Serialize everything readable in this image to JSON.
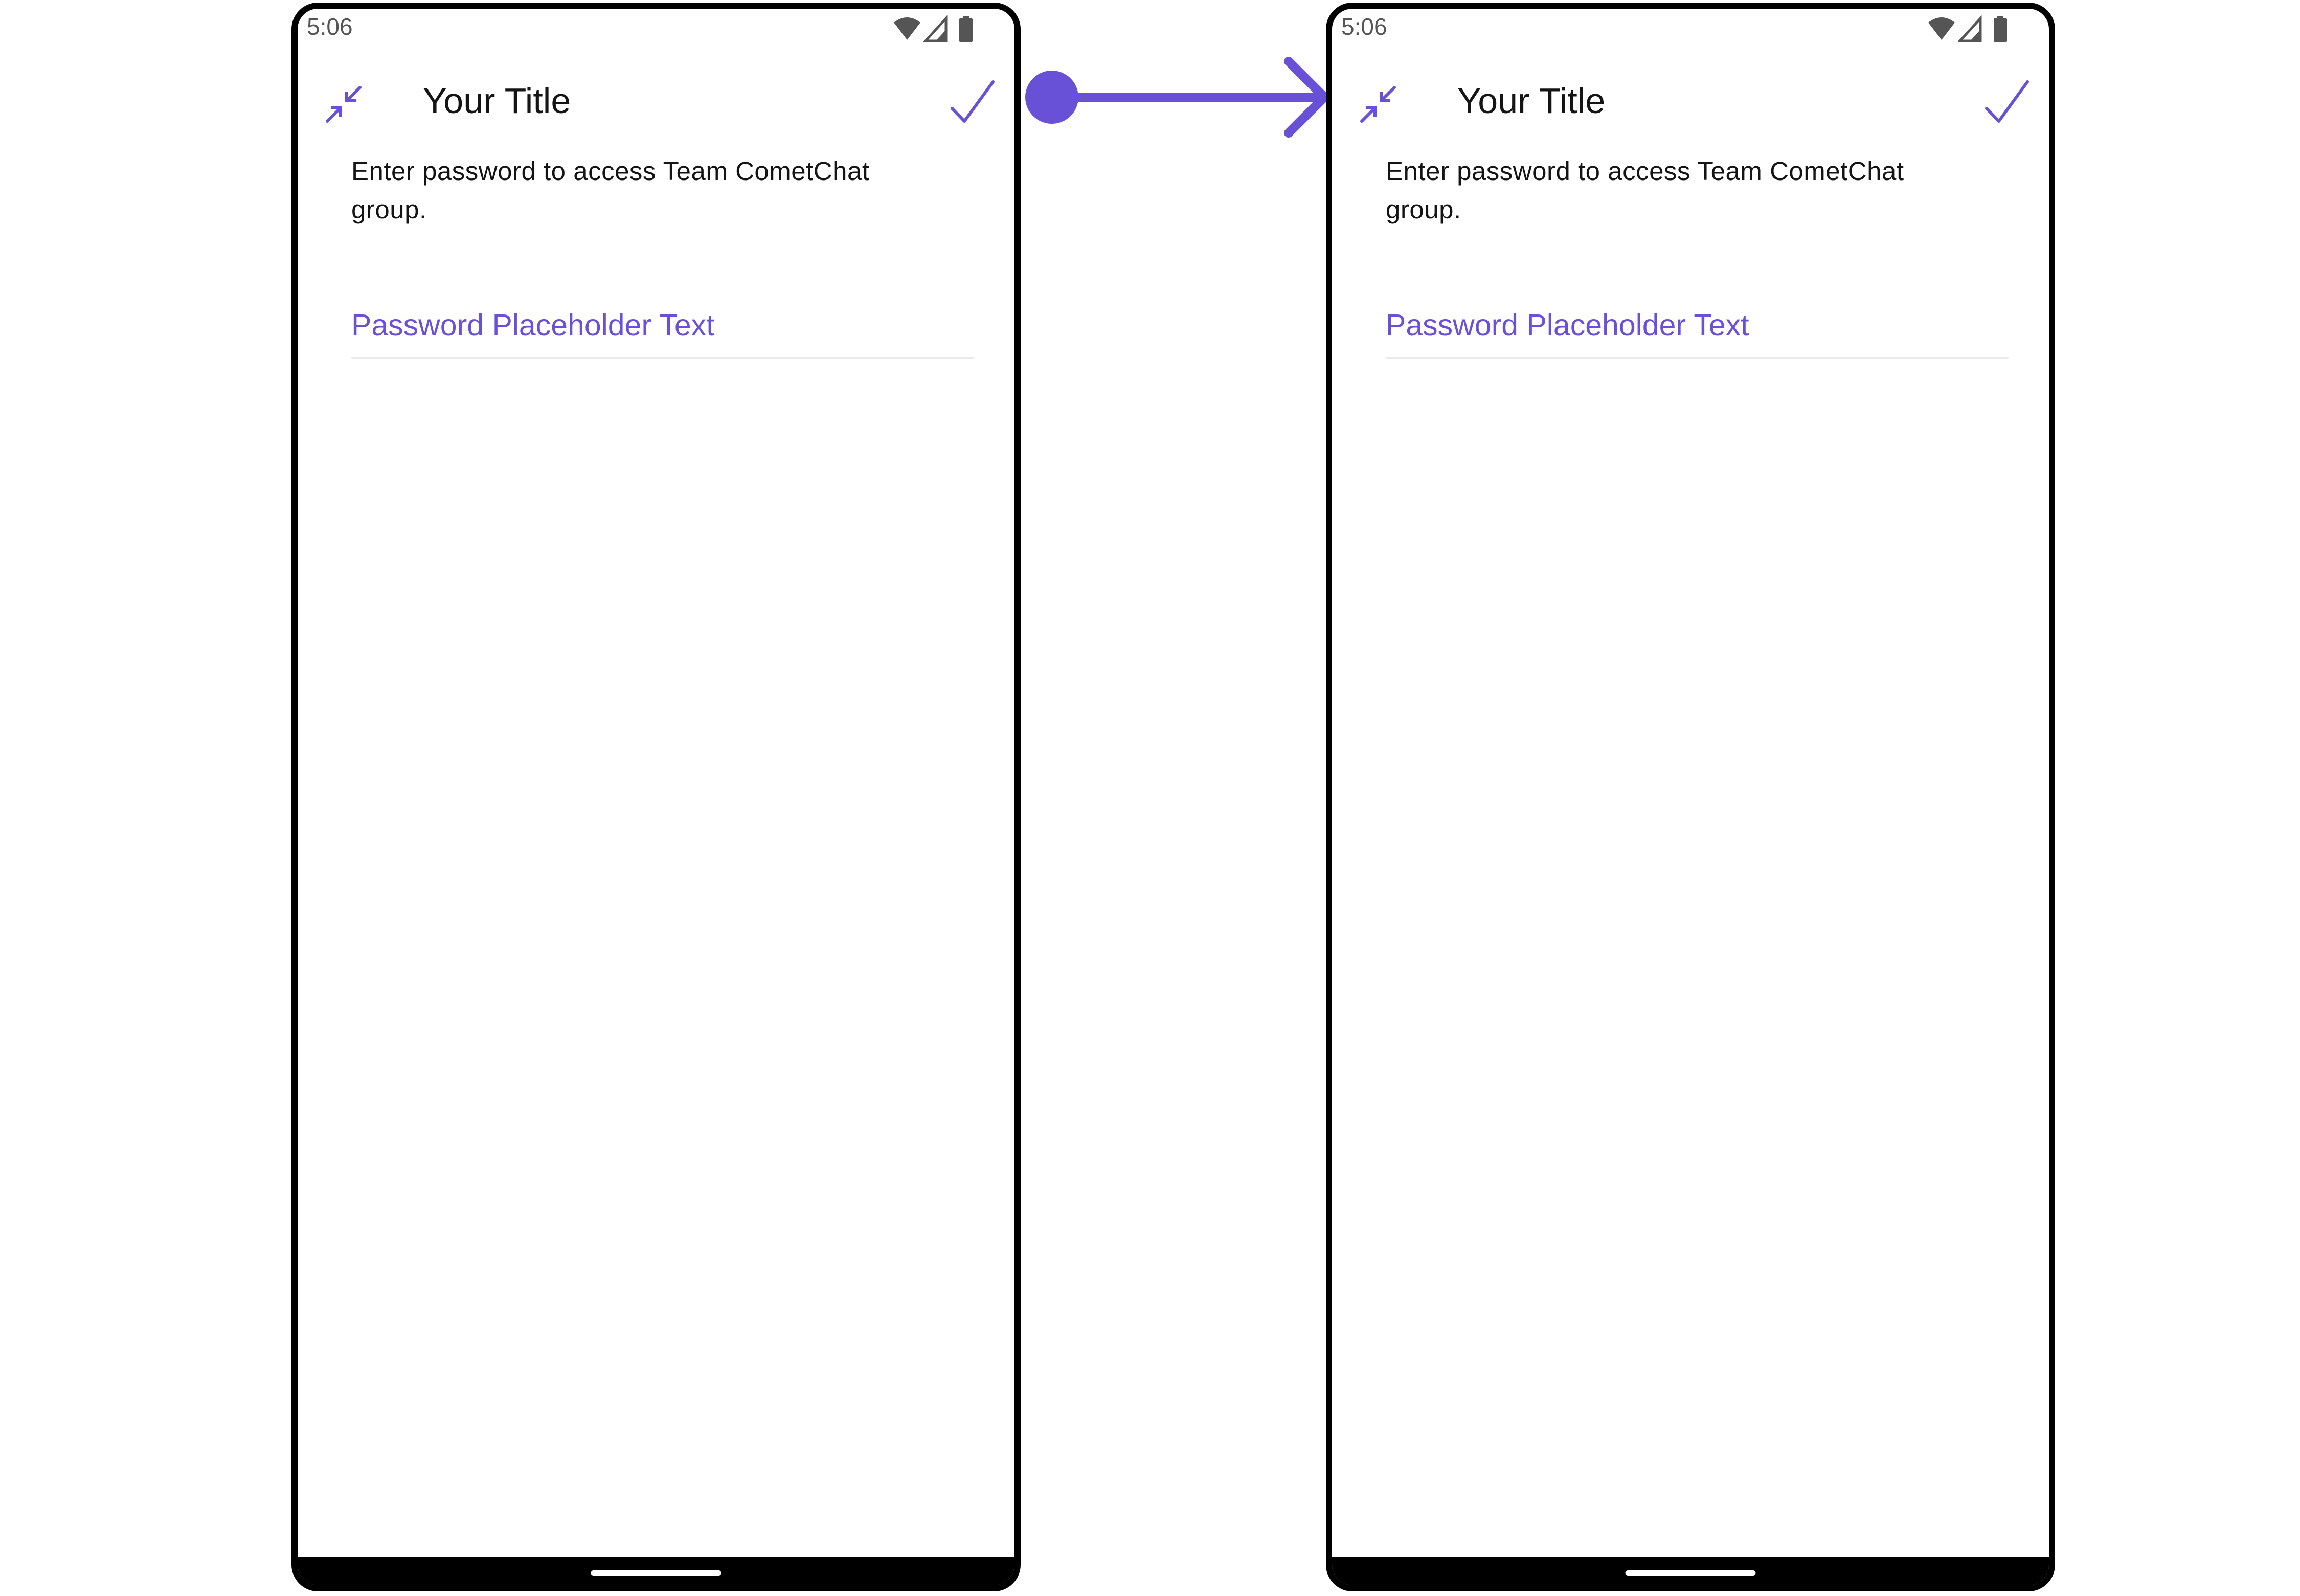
{
  "screens": [
    {
      "status_bar": {
        "time": "5:06",
        "icons": [
          "wifi-icon",
          "cell-signal-icon",
          "battery-icon"
        ]
      },
      "header": {
        "back_icon": "collapse-arrows-icon",
        "title": "Your Title",
        "confirm_icon": "check-icon"
      },
      "description": "Enter password to access Team CometChat group.",
      "password_input": {
        "placeholder": "Password Placeholder Text",
        "value": ""
      }
    },
    {
      "status_bar": {
        "time": "5:06",
        "icons": [
          "wifi-icon",
          "cell-signal-icon",
          "battery-icon"
        ]
      },
      "header": {
        "back_icon": "collapse-arrows-icon",
        "title": "Your Title",
        "confirm_icon": "check-icon"
      },
      "description": "Enter password to access Team CometChat group.",
      "password_input": {
        "placeholder": "Password Placeholder Text",
        "value": ""
      }
    }
  ],
  "connector": {
    "icon": "arrow-right-icon"
  },
  "colors": {
    "accent": "#6851D6",
    "text": "#141414",
    "status_text": "#555555",
    "divider": "#EBEBEB",
    "frame": "#000000"
  }
}
